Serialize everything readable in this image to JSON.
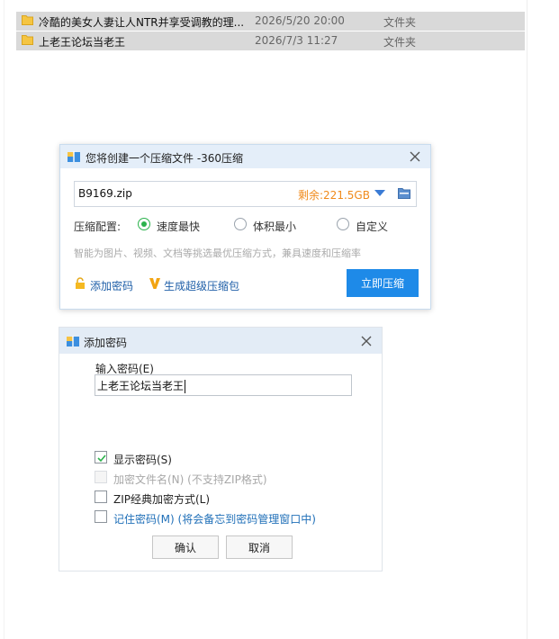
{
  "explorer": {
    "files": [
      {
        "name": "冷酷的美女人妻让人NTR并享受调教的理...",
        "date": "2026/5/20 20:00",
        "type": "文件夹"
      },
      {
        "name": "上老王论坛当老王",
        "date": "2026/7/3 11:27",
        "type": "文件夹"
      }
    ]
  },
  "compress_dialog": {
    "title": "您将创建一个压缩文件 -360压缩",
    "filename": "B9169.zip",
    "space_left": "剩余:221.5GB",
    "config_label": "压缩配置:",
    "options": [
      {
        "label": "速度最快",
        "checked": true
      },
      {
        "label": "体积最小",
        "checked": false
      },
      {
        "label": "自定义",
        "checked": false
      }
    ],
    "hint": "智能为图片、视频、文档等挑选最优压缩方式，兼具速度和压缩率",
    "add_password_label": "添加密码",
    "super_pack_label": "生成超级压缩包",
    "compress_button": "立即压缩"
  },
  "password_dialog": {
    "title": "添加密码",
    "input_label": "输入密码(E)",
    "password_value": "上老王论坛当老王",
    "options": [
      {
        "label": "显示密码(S)",
        "note": "",
        "checked": true,
        "disabled": false
      },
      {
        "label": "加密文件名(N)",
        "note": " (不支持ZIP格式)",
        "checked": false,
        "disabled": true
      },
      {
        "label": "ZIP经典加密方式(L)",
        "note": "",
        "checked": false,
        "disabled": false
      },
      {
        "label": "记住密码(M)",
        "note": " (将会备忘到密码管理窗口中)",
        "checked": false,
        "disabled": false
      }
    ],
    "ok_button": "确认",
    "cancel_button": "取消"
  },
  "colors": {
    "accent_blue": "#1e8ae8",
    "checkbox_green": "#2bb24c",
    "space_orange": "#f08a1b",
    "link_blue": "#1f5fa8"
  },
  "icons": {
    "folder": "folder-icon",
    "app": "archive-app-icon",
    "close": "close-icon",
    "dropdown": "triangle-down-icon",
    "browse": "folder-browse-icon",
    "lock": "lock-icon",
    "super": "v-badge-icon",
    "check": "checkmark-icon"
  }
}
